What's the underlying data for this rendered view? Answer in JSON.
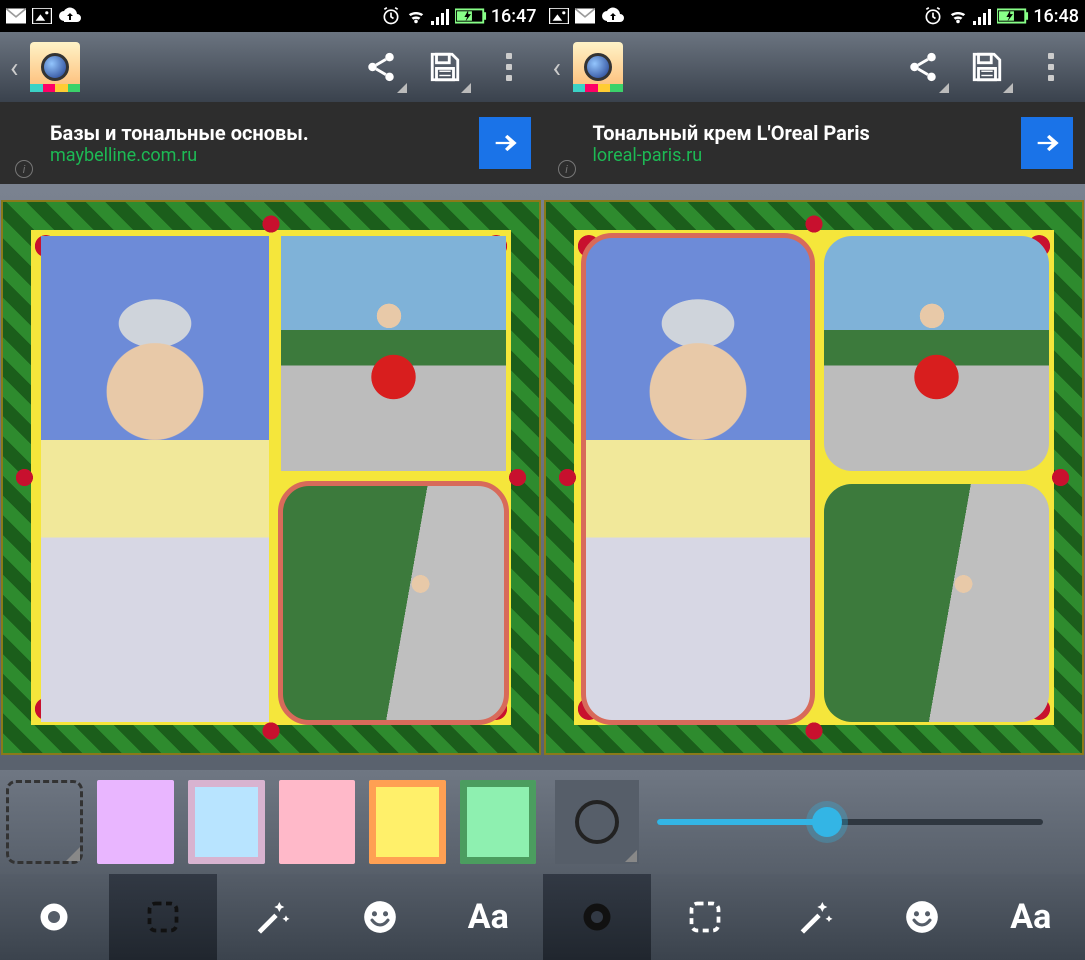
{
  "left": {
    "status": {
      "time": "16:47"
    },
    "appbar": {},
    "ad": {
      "title": "Базы и тональные основы.",
      "domain": "maybelline.com.ru"
    },
    "canvas": {
      "selected_slot": 2,
      "selected_rounded": true,
      "slot_round": [
        false,
        false,
        true
      ]
    },
    "frame_options": [
      {
        "name": "no-frame"
      },
      {
        "name": "purple-roses"
      },
      {
        "name": "blue-flowers"
      },
      {
        "name": "pink-hearts"
      },
      {
        "name": "yellow-holly"
      },
      {
        "name": "green-pine"
      }
    ],
    "tabs": {
      "active_index": 1
    }
  },
  "right": {
    "status": {
      "time": "16:48"
    },
    "appbar": {},
    "ad": {
      "title": "Тональный крем L'Oreal Paris",
      "domain": "loreal-paris.ru"
    },
    "canvas": {
      "selected_slot": 0,
      "selected_rounded": true,
      "slot_round": [
        true,
        true,
        true
      ]
    },
    "slider": {
      "value_pct": 44
    },
    "tabs": {
      "active_index": 0
    }
  },
  "common": {
    "tab_labels": {
      "text": "Aa"
    }
  }
}
